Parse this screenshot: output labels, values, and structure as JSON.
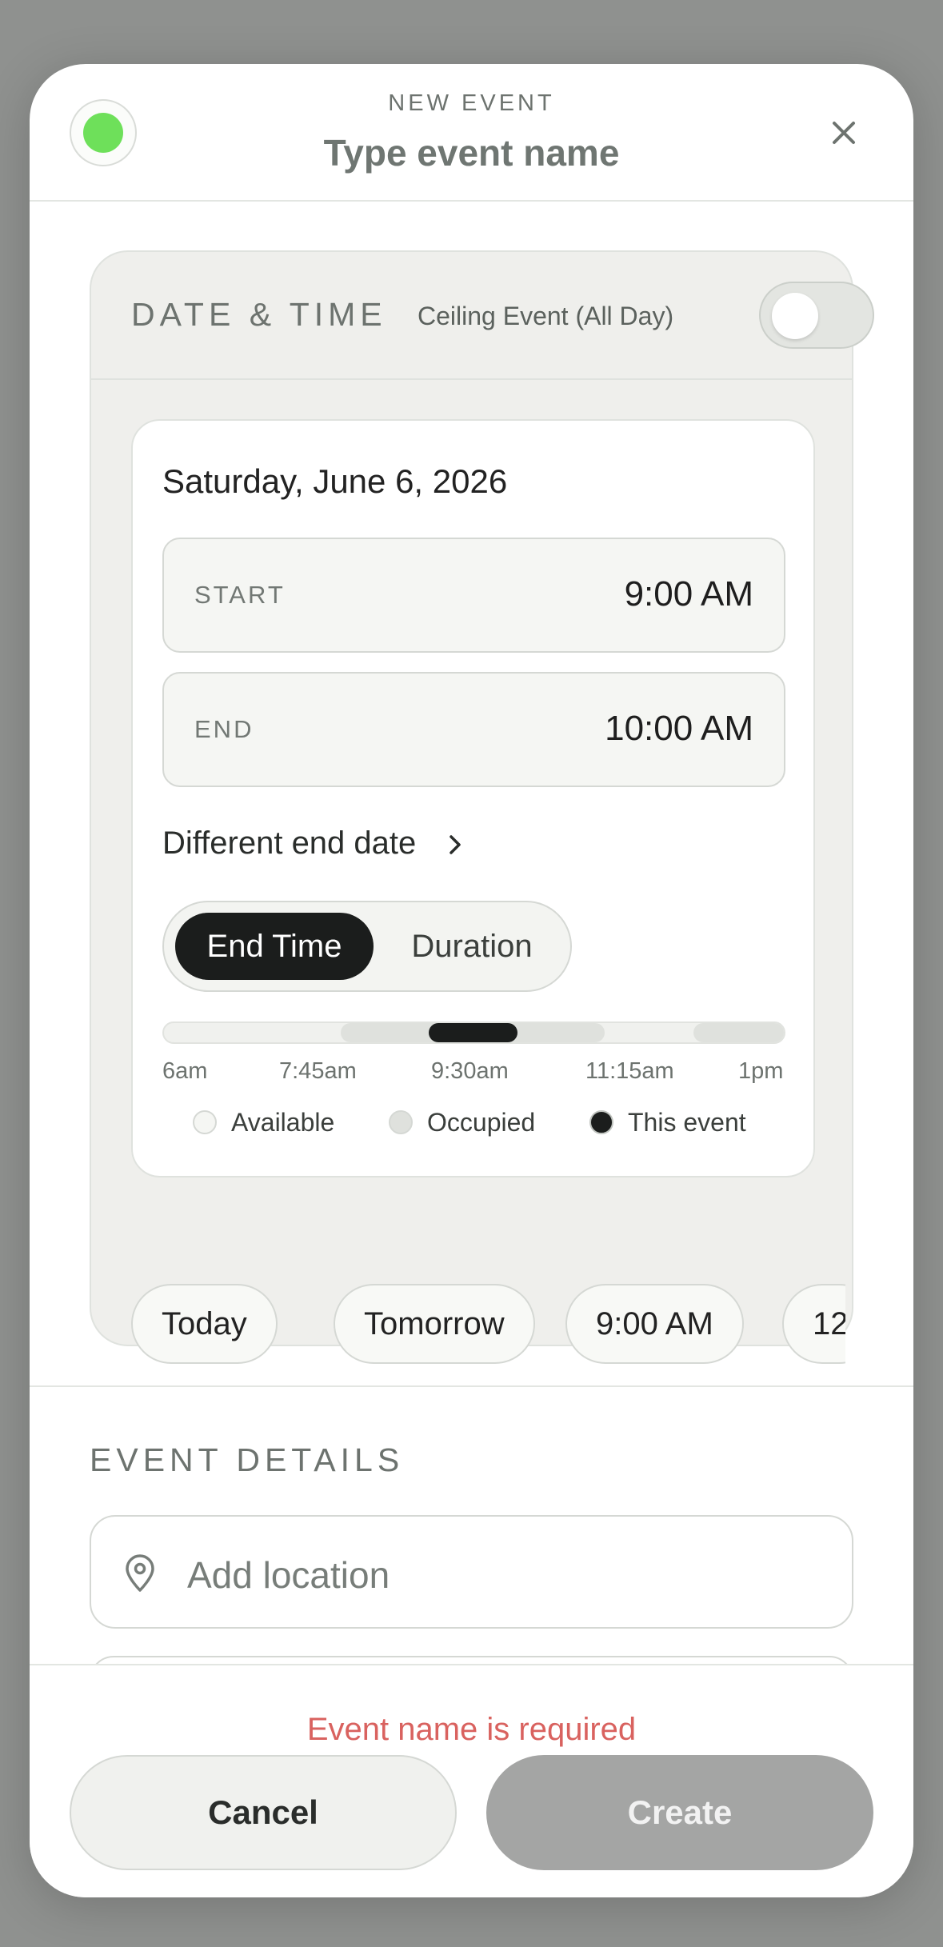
{
  "header": {
    "subtitle": "NEW EVENT",
    "title_placeholder": "Type event name",
    "color_dot": "#6ee05a",
    "close_icon": "close-icon"
  },
  "date_time": {
    "section_label": "DATE & TIME",
    "ceiling_label": "Ceiling Event (All Day)",
    "ceiling_on": false,
    "date": "Saturday, June 6, 2026",
    "start": {
      "label": "START",
      "value": "9:00 AM"
    },
    "end": {
      "label": "END",
      "value": "10:00 AM"
    },
    "different_end_date": "Different end date",
    "segmented": {
      "active": "End Time",
      "inactive": "Duration"
    },
    "timeline": {
      "ticks": [
        "6am",
        "7:45am",
        "9:30am",
        "11:15am",
        "1pm"
      ],
      "legend": {
        "available": "Available",
        "occupied": "Occupied",
        "this_event": "This event"
      }
    },
    "quick_chips": [
      "Today",
      "Tomorrow",
      "9:00 AM",
      "12"
    ]
  },
  "event_details": {
    "section_label": "EVENT DETAILS",
    "location_placeholder": "Add location"
  },
  "footer": {
    "error": "Event name is required",
    "cancel": "Cancel",
    "create": "Create"
  },
  "colors": {
    "accent_dark": "#1b1d1c",
    "error": "#d9625f",
    "create_disabled": "#a4a5a4"
  }
}
